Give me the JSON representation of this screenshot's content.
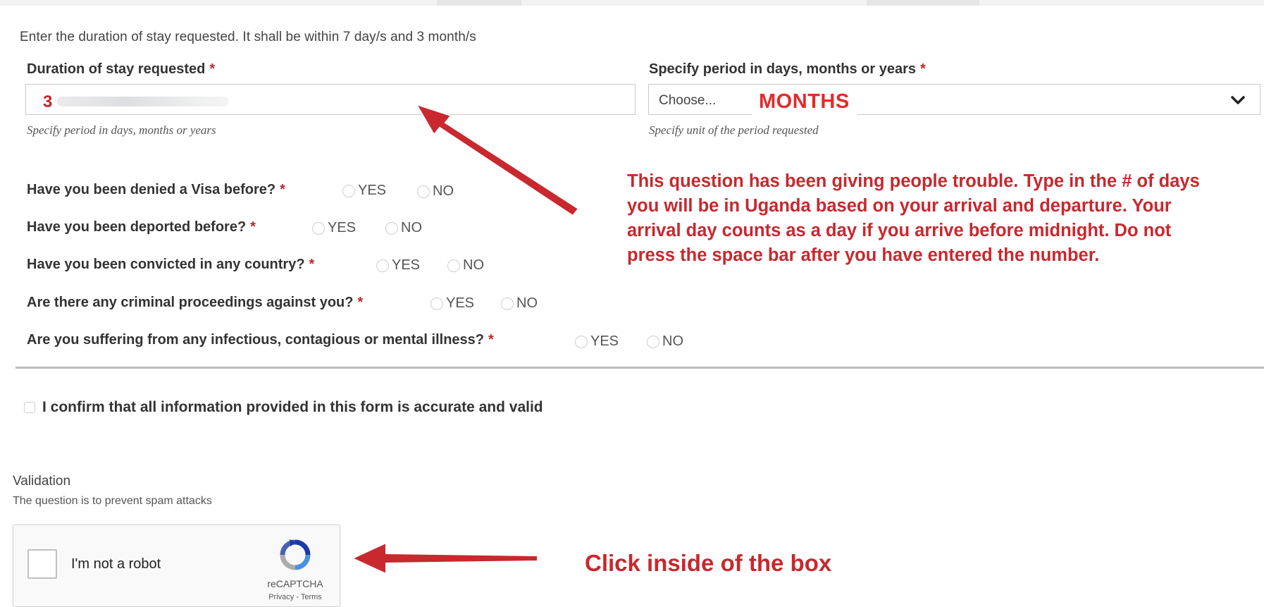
{
  "hint": "Enter the duration of stay requested. It shall be within 7 day/s and 3 month/s",
  "duration": {
    "label": "Duration of stay requested",
    "required": "*",
    "value": "3",
    "help": "Specify period in days, months or years"
  },
  "period": {
    "label": "Specify period in days, months or years",
    "required": "*",
    "placeholder": "Choose...",
    "overlay_value": "MONTHS",
    "help": "Specify unit of the period requested"
  },
  "questions": [
    {
      "text": "Have you been denied a Visa before?",
      "yes": "YES",
      "no": "NO"
    },
    {
      "text": "Have you been deported before?",
      "yes": "YES",
      "no": "NO"
    },
    {
      "text": "Have you been convicted in any country?",
      "yes": "YES",
      "no": "NO"
    },
    {
      "text": "Are there any criminal proceedings against you?",
      "yes": "YES",
      "no": "NO"
    },
    {
      "text": "Are you suffering from any infectious, contagious or mental illness?",
      "yes": "YES",
      "no": "NO"
    }
  ],
  "required_mark": "*",
  "confirm": "I confirm that all information provided in this form is accurate and valid",
  "validation": {
    "title": "Validation",
    "subtitle": "The question is to prevent spam attacks"
  },
  "recaptcha": {
    "label": "I'm not a robot",
    "brand": "reCAPTCHA",
    "terms": "Privacy - Terms"
  },
  "annotations": {
    "note_lines": [
      "This question has been giving people trouble. Type in the # of days",
      "you will be in Uganda based on your arrival and departure. Your",
      "arrival day counts as a day if you arrive before midnight. Do not",
      "press the space bar after you have entered the number."
    ],
    "click_note": "Click inside of the box",
    "color": "#c8282e"
  },
  "colors": {
    "required": "#c0272d",
    "annotation": "#c8282e"
  }
}
